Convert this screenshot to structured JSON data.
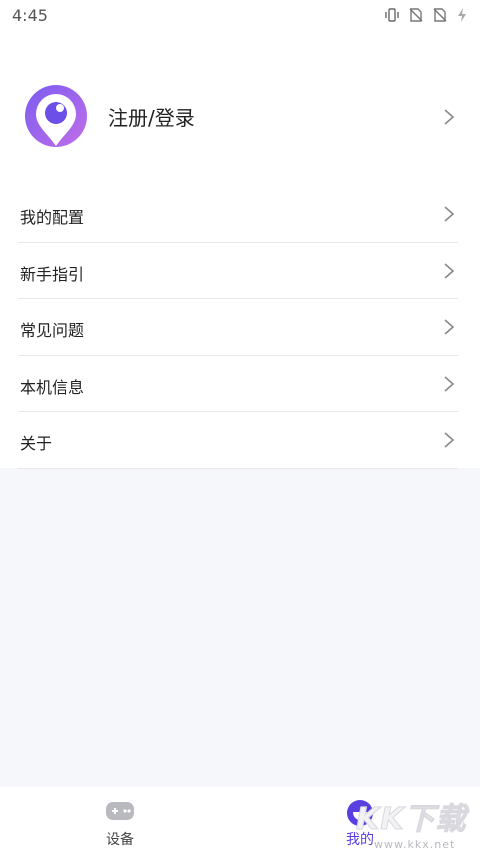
{
  "status_bar": {
    "time": "4:45",
    "icons": [
      "vibrate-icon",
      "no-sim-icon",
      "no-sim-icon",
      "charging-icon"
    ]
  },
  "profile": {
    "login_label": "注册/登录"
  },
  "menu": {
    "items": [
      {
        "label": "我的配置"
      },
      {
        "label": "新手指引"
      },
      {
        "label": "常见问题"
      },
      {
        "label": "本机信息"
      },
      {
        "label": "关于"
      }
    ]
  },
  "tabbar": {
    "tabs": [
      {
        "label": "设备",
        "icon": "gamepad-icon",
        "active": false
      },
      {
        "label": "我的",
        "icon": "smile-icon",
        "active": true
      }
    ]
  },
  "watermark": {
    "brand": "KK下载",
    "url": "www.kkx.net"
  },
  "colors": {
    "accent": "#5a3fe0",
    "avatar_gradient_start": "#7b5cf0",
    "avatar_gradient_end": "#c06ee8",
    "background": "#f6f7fa"
  }
}
